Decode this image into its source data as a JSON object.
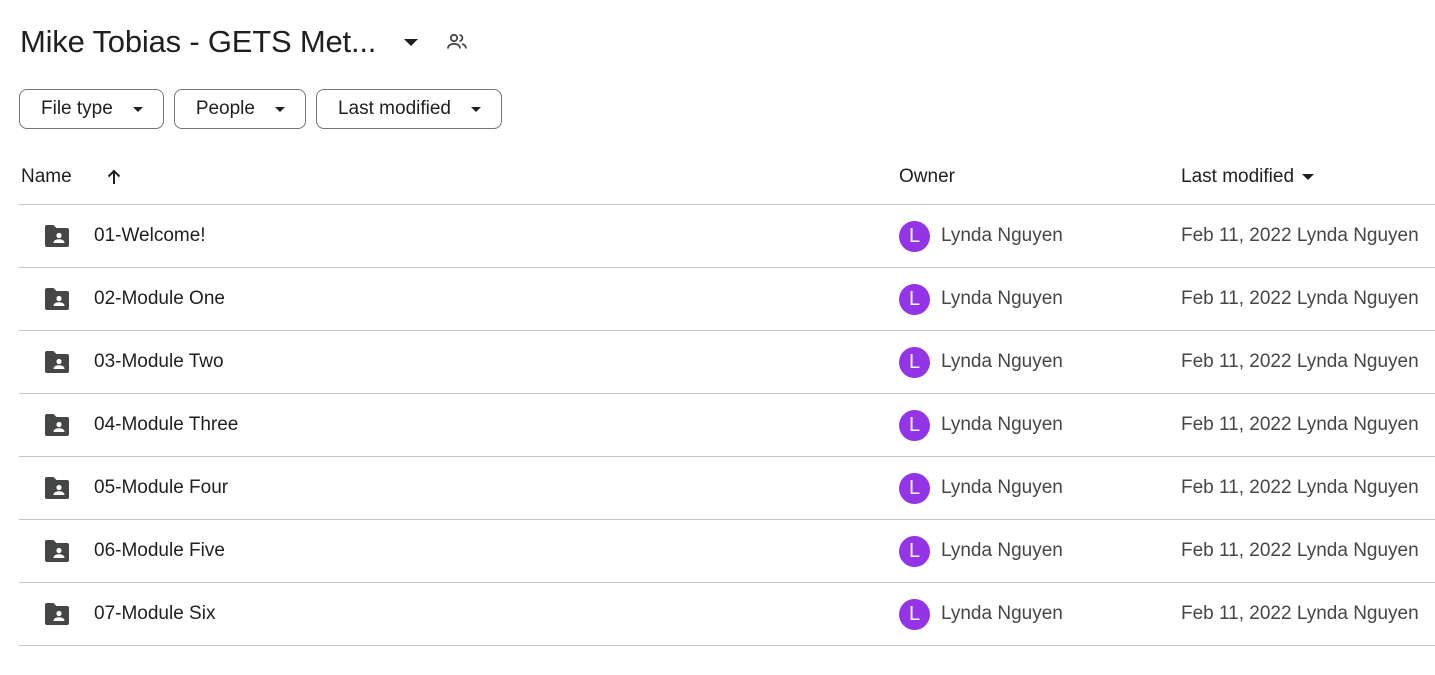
{
  "header": {
    "title": "Mike Tobias - GETS Met...",
    "dropdown_icon": "arrow-drop-down-icon",
    "share_icon": "people-icon"
  },
  "filters": [
    {
      "label": "File type"
    },
    {
      "label": "People"
    },
    {
      "label": "Last modified"
    }
  ],
  "table": {
    "columns": {
      "name": "Name",
      "owner": "Owner",
      "last_modified": "Last modified"
    },
    "sort_icon": "arrow-up-icon",
    "rows": [
      {
        "name": "01-Welcome!",
        "owner_initial": "L",
        "owner": "Lynda Nguyen",
        "modified": "Feb 11, 2022 Lynda Nguyen"
      },
      {
        "name": "02-Module One",
        "owner_initial": "L",
        "owner": "Lynda Nguyen",
        "modified": "Feb 11, 2022 Lynda Nguyen"
      },
      {
        "name": "03-Module Two",
        "owner_initial": "L",
        "owner": "Lynda Nguyen",
        "modified": "Feb 11, 2022 Lynda Nguyen"
      },
      {
        "name": "04-Module Three",
        "owner_initial": "L",
        "owner": "Lynda Nguyen",
        "modified": "Feb 11, 2022 Lynda Nguyen"
      },
      {
        "name": "05-Module Four",
        "owner_initial": "L",
        "owner": "Lynda Nguyen",
        "modified": "Feb 11, 2022 Lynda Nguyen"
      },
      {
        "name": "06-Module Five",
        "owner_initial": "L",
        "owner": "Lynda Nguyen",
        "modified": "Feb 11, 2022 Lynda Nguyen"
      },
      {
        "name": "07-Module Six",
        "owner_initial": "L",
        "owner": "Lynda Nguyen",
        "modified": "Feb 11, 2022 Lynda Nguyen"
      }
    ]
  },
  "colors": {
    "avatar": "#9334e6",
    "folder_icon": "#444746",
    "divider": "#c7c7c7"
  }
}
